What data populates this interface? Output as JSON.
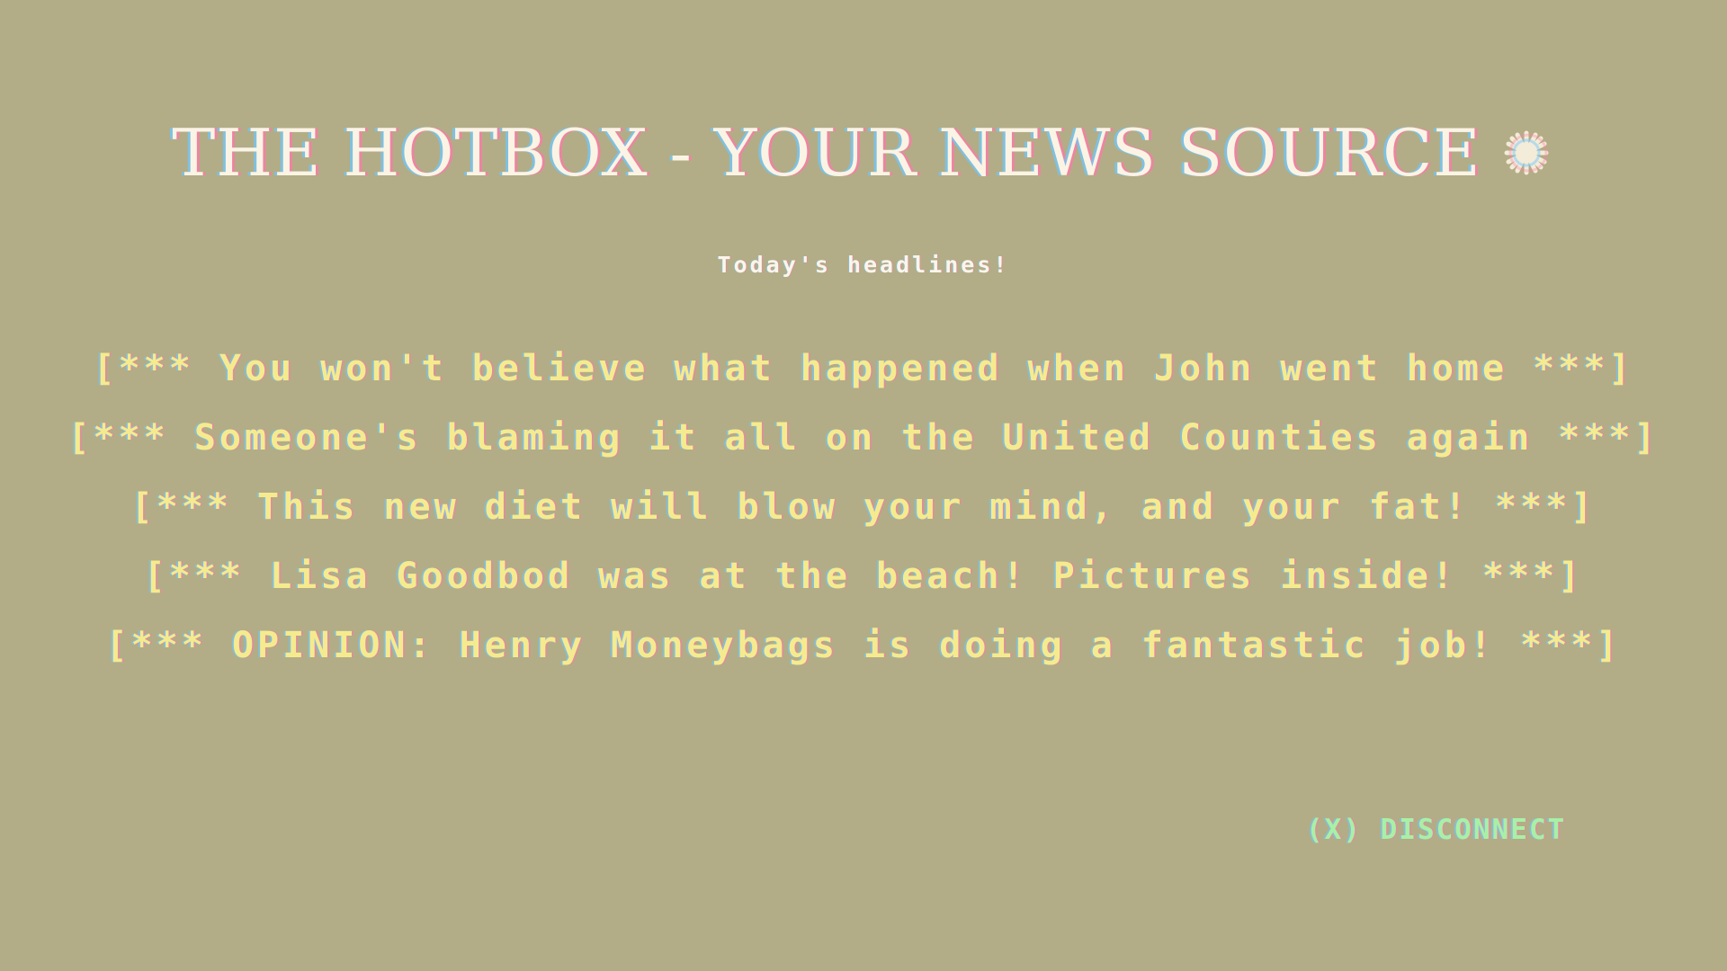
{
  "masthead": {
    "title": "THE HOTBOX - YOUR NEWS SOURCE",
    "icon": "sparkle-burst-icon"
  },
  "subtitle": "Today's headlines!",
  "headlines": [
    "[*** You won't believe what happened when John went home ***]",
    "[*** Someone's blaming it all on the United Counties again ***]",
    "[*** This new diet will blow your mind, and your fat! ***]",
    "[*** Lisa Goodbod was at the beach! Pictures inside! ***]",
    "[*** OPINION: Henry Moneybags is doing a fantastic job! ***]"
  ],
  "disconnect": {
    "label": "(X) DISCONNECT"
  },
  "colors": {
    "background": "#b2ad86",
    "title": "#fbf4e4",
    "headline": "#f5eb8e",
    "disconnect": "#a9f0a6"
  }
}
